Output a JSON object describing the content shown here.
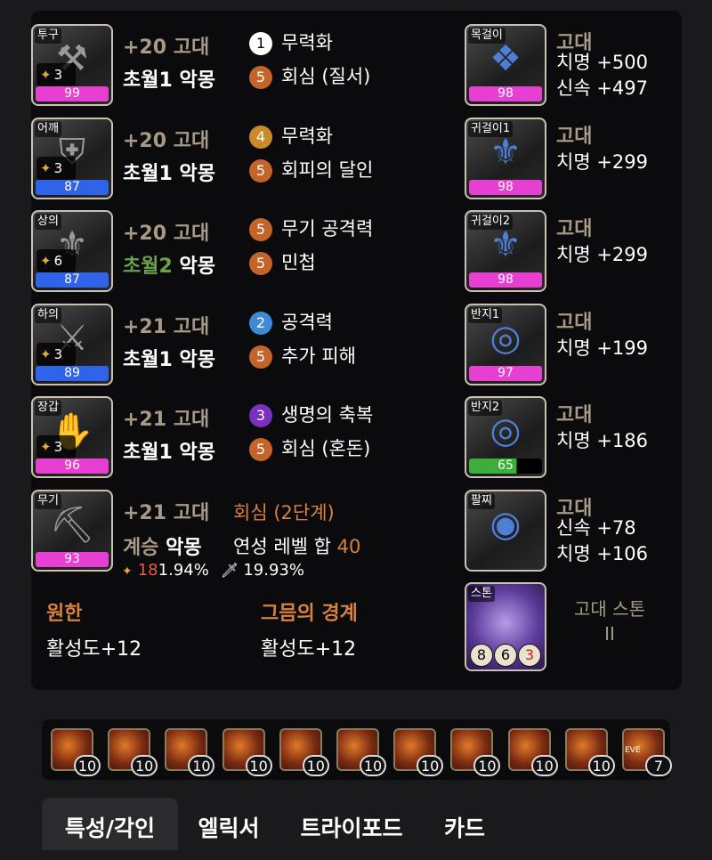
{
  "equipment": [
    {
      "slot": "투구",
      "level": "3",
      "quality": "99",
      "qcolor": "pink",
      "honing": "+20 고대",
      "set_prefix": "초월1",
      "set": "악몽",
      "engr1_num": "1",
      "engr1": "무력화",
      "engr1_color": "white",
      "engr2_num": "5",
      "engr2": "회심 (질서)",
      "engr2_color": "orange"
    },
    {
      "slot": "어깨",
      "level": "3",
      "quality": "87",
      "qcolor": "blue",
      "honing": "+20 고대",
      "set_prefix": "초월1",
      "set": "악몽",
      "engr1_num": "4",
      "engr1": "무력화",
      "engr1_color": "yellow",
      "engr2_num": "5",
      "engr2": "회피의 달인",
      "engr2_color": "orange"
    },
    {
      "slot": "상의",
      "level": "6",
      "quality": "87",
      "qcolor": "blue",
      "honing": "+20 고대",
      "set_prefix": "초월2",
      "set": "악몽",
      "engr1_num": "5",
      "engr1": "무기 공격력",
      "engr1_color": "orange",
      "engr2_num": "5",
      "engr2": "민첩",
      "engr2_color": "orange"
    },
    {
      "slot": "하의",
      "level": "3",
      "quality": "89",
      "qcolor": "blue",
      "honing": "+21 고대",
      "set_prefix": "초월1",
      "set": "악몽",
      "engr1_num": "2",
      "engr1": "공격력",
      "engr1_color": "blue",
      "engr2_num": "5",
      "engr2": "추가 피해",
      "engr2_color": "orange"
    },
    {
      "slot": "장갑",
      "level": "3",
      "quality": "96",
      "qcolor": "pink",
      "honing": "+21 고대",
      "set_prefix": "초월1",
      "set": "악몽",
      "engr1_num": "3",
      "engr1": "생명의 축복",
      "engr1_color": "purple",
      "engr2_num": "5",
      "engr2": "회심 (혼돈)",
      "engr2_color": "orange"
    }
  ],
  "weapon": {
    "slot": "무기",
    "quality": "93",
    "honing": "+21 고대",
    "effect": "회심 (2단계)",
    "set_prefix": "계승",
    "set": "악몽",
    "total_label": "연성 레벨 합",
    "total_value": "40",
    "stat1_num": "18",
    "stat1_pct": "1.94%",
    "stat2_pct": "19.93%"
  },
  "bracelet_effects": [
    {
      "name": "원한",
      "value": "활성도+12"
    },
    {
      "name": "그믐의 경계",
      "value": "활성도+12"
    }
  ],
  "accessories": [
    {
      "slot": "목걸이",
      "quality": "98",
      "qcolor": "pink",
      "grade": "고대",
      "stats": [
        "치명 +500",
        "신속 +497"
      ]
    },
    {
      "slot": "귀걸이1",
      "quality": "98",
      "qcolor": "pink",
      "grade": "고대",
      "stats": [
        "치명 +299"
      ]
    },
    {
      "slot": "귀걸이2",
      "quality": "98",
      "qcolor": "pink",
      "grade": "고대",
      "stats": [
        "치명 +299"
      ]
    },
    {
      "slot": "반지1",
      "quality": "97",
      "qcolor": "pink",
      "grade": "고대",
      "stats": [
        "치명 +199"
      ]
    },
    {
      "slot": "반지2",
      "quality": "65",
      "qcolor": "green",
      "grade": "고대",
      "stats": [
        "치명 +186"
      ]
    },
    {
      "slot": "팔찌",
      "quality": "",
      "qcolor": "",
      "grade": "고대",
      "stats": [
        "신속 +78",
        "치명 +106"
      ]
    }
  ],
  "stone": {
    "slot": "스톤",
    "label": "고대 스톤",
    "label2": "II",
    "n1": "8",
    "n2": "6",
    "n3": "3"
  },
  "gems": [
    {
      "level": "10",
      "label": ""
    },
    {
      "level": "10",
      "label": ""
    },
    {
      "level": "10",
      "label": ""
    },
    {
      "level": "10",
      "label": ""
    },
    {
      "level": "10",
      "label": ""
    },
    {
      "level": "10",
      "label": ""
    },
    {
      "level": "10",
      "label": ""
    },
    {
      "level": "10",
      "label": ""
    },
    {
      "level": "10",
      "label": ""
    },
    {
      "level": "10",
      "label": ""
    },
    {
      "level": "7",
      "label": "EVE"
    }
  ],
  "tabs": [
    "특성/각인",
    "엘릭서",
    "트라이포드",
    "카드"
  ]
}
